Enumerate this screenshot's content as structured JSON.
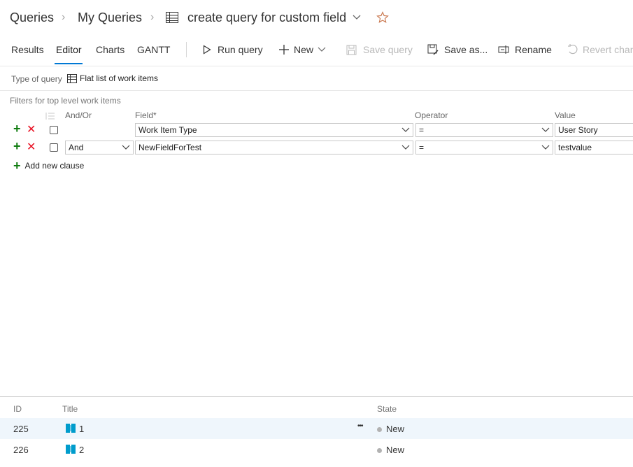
{
  "breadcrumb": {
    "root": "Queries",
    "folder": "My Queries",
    "query_name": "create query for custom field"
  },
  "tabs": [
    {
      "label": "Results",
      "active": false
    },
    {
      "label": "Editor",
      "active": true
    },
    {
      "label": "Charts",
      "active": false
    },
    {
      "label": "GANTT",
      "active": false
    }
  ],
  "toolbar": {
    "run_query": "Run query",
    "new": "New",
    "save_query": "Save query",
    "save_as": "Save as...",
    "rename": "Rename",
    "revert": "Revert chan"
  },
  "query_type": {
    "label": "Type of query",
    "value": "Flat list of work items"
  },
  "filters": {
    "section_label": "Filters for top level work items",
    "headers": {
      "and_or": "And/Or",
      "field": "Field*",
      "operator": "Operator",
      "value": "Value"
    },
    "clauses": [
      {
        "and_or": "",
        "field": "Work Item Type",
        "operator": "=",
        "value": "User Story"
      },
      {
        "and_or": "And",
        "field": "NewFieldForTest",
        "operator": "=",
        "value": "testvalue"
      }
    ],
    "add_clause": "Add new clause"
  },
  "results": {
    "headers": {
      "id": "ID",
      "title": "Title",
      "state": "State"
    },
    "rows": [
      {
        "id": "225",
        "title": "1",
        "state": "New"
      },
      {
        "id": "226",
        "title": "2",
        "state": "New"
      }
    ],
    "more": "•••"
  },
  "colors": {
    "accent": "#0078d4",
    "add": "#107c10",
    "remove": "#e81123",
    "favorite": "#c8744a"
  }
}
